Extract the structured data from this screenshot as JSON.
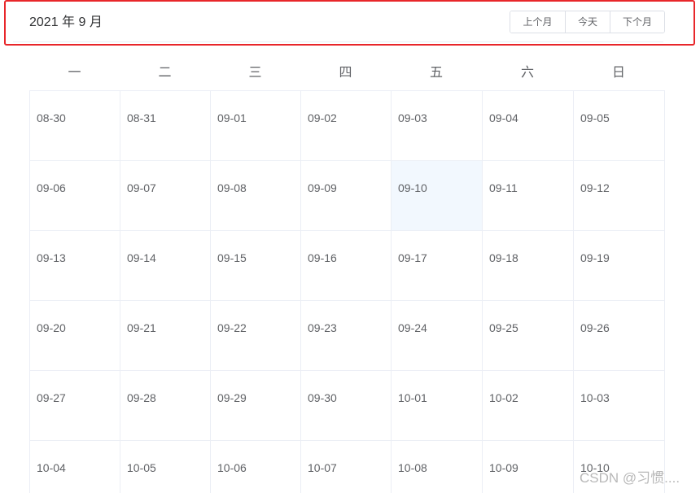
{
  "header": {
    "title": "2021 年 9 月",
    "buttons": {
      "prev": "上个月",
      "today": "今天",
      "next": "下个月"
    }
  },
  "weekdays": [
    "一",
    "二",
    "三",
    "四",
    "五",
    "六",
    "日"
  ],
  "weeks": [
    [
      "08-30",
      "08-31",
      "09-01",
      "09-02",
      "09-03",
      "09-04",
      "09-05"
    ],
    [
      "09-06",
      "09-07",
      "09-08",
      "09-09",
      "09-10",
      "09-11",
      "09-12"
    ],
    [
      "09-13",
      "09-14",
      "09-15",
      "09-16",
      "09-17",
      "09-18",
      "09-19"
    ],
    [
      "09-20",
      "09-21",
      "09-22",
      "09-23",
      "09-24",
      "09-25",
      "09-26"
    ],
    [
      "09-27",
      "09-28",
      "09-29",
      "09-30",
      "10-01",
      "10-02",
      "10-03"
    ],
    [
      "10-04",
      "10-05",
      "10-06",
      "10-07",
      "10-08",
      "10-09",
      "10-10"
    ]
  ],
  "selected_date": "09-10",
  "colors": {
    "highlight_border": "#e8262a",
    "selected_background": "#f2f8fe",
    "text": "#606266",
    "grid_border": "#ebeef5"
  },
  "watermark": "CSDN @习惯...."
}
